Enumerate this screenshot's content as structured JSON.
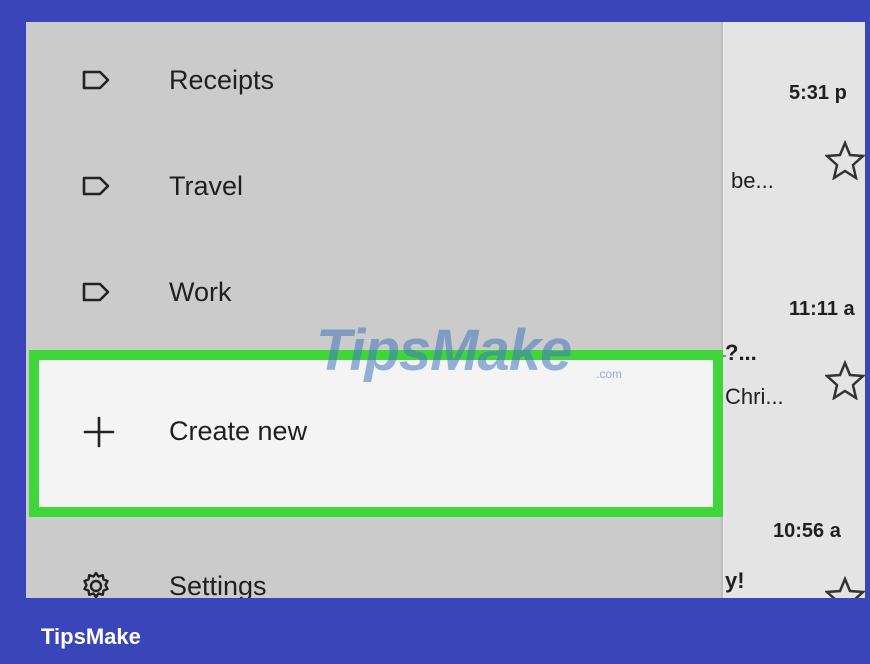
{
  "drawer": {
    "items": [
      {
        "label": "Receipts",
        "icon": "label-icon"
      },
      {
        "label": "Travel",
        "icon": "label-icon"
      },
      {
        "label": "Work",
        "icon": "label-icon"
      },
      {
        "label": "Create new",
        "icon": "plus-icon"
      },
      {
        "label": "Settings",
        "icon": "gear-icon"
      }
    ]
  },
  "mail_list": {
    "times": [
      "5:31 p",
      "11:11 a",
      "10:56 a"
    ],
    "snippets": [
      "be...",
      "?...",
      "Chri...",
      "y!"
    ]
  },
  "watermark": {
    "text": "TipsMake",
    "suffix": ".com"
  },
  "caption": {
    "text": "TipsMake"
  },
  "colors": {
    "frame": "#3a45b9",
    "highlight": "#3fd63a",
    "drawer": "#cbcbcb"
  }
}
